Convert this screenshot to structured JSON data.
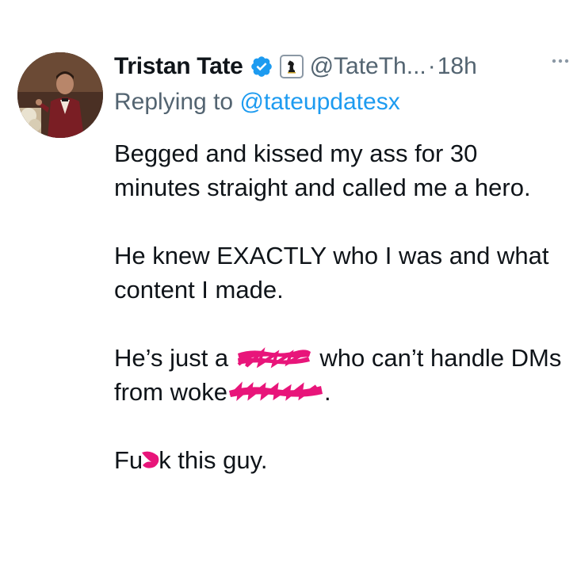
{
  "author": {
    "display_name": "Tristan Tate",
    "handle": "@TateTh...",
    "separator": "·",
    "time": "18h",
    "verified_icon": "verified-badge-icon",
    "affiliate_icon": "affiliate-badge-icon"
  },
  "reply": {
    "prefix": "Replying to ",
    "mention": "@tateupdatesx"
  },
  "tweet_text": {
    "para1": "Begged and kissed my ass for 30 minutes straight and called me a hero.",
    "para2": "He knew EXACTLY who I was and what content I made.",
    "para3_a": "He’s just a ",
    "para3_b": " who can’t handle DMs from woke",
    "para3_c": ".",
    "para4_a": "Fu",
    "para4_b": "k this guy."
  },
  "colors": {
    "link": "#1d9bf0",
    "secondary_text": "#536471",
    "redaction": "#e8157a"
  }
}
